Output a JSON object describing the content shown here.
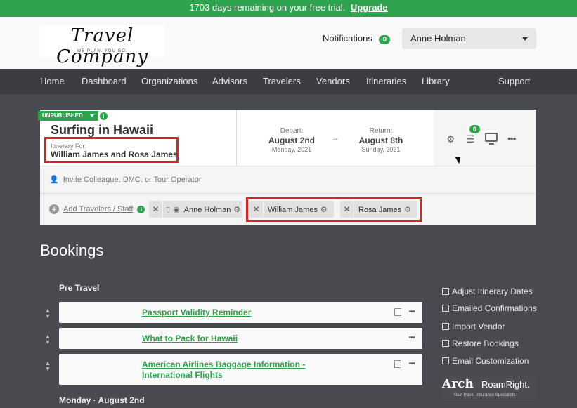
{
  "trial_bar": {
    "text": "1703 days remaining on your free trial.",
    "link": "Upgrade"
  },
  "header": {
    "logo": {
      "title": "Travel Company",
      "tagline": "WE PLAN. YOU GO."
    },
    "notifications_label": "Notifications",
    "notifications_count": "0",
    "user_name": "Anne Holman"
  },
  "nav": [
    "Home",
    "Dashboard",
    "Organizations",
    "Advisors",
    "Travelers",
    "Vendors",
    "Itineraries",
    "Library",
    "Support"
  ],
  "itinerary": {
    "status": "UNPUBLISHED",
    "title": "Surfing in Hawaii",
    "for_label": "Itinerary For:",
    "for_names": "William James and Rosa James",
    "depart": {
      "label": "Depart:",
      "date": "August 2nd",
      "sub": "Monday, 2021"
    },
    "return": {
      "label": "Return:",
      "date": "August 8th",
      "sub": "Sunday, 2021"
    },
    "arrow": "→",
    "checklist_count": "0",
    "invite_text": "Invite Colleague, DMC, or Tour Operator",
    "add_travelers_text": "Add Travelers / Staff",
    "travelers": [
      "Anne Holman",
      "William James",
      "Rosa James"
    ]
  },
  "bookings": {
    "title": "Bookings",
    "sections": [
      {
        "heading": "Pre Travel",
        "items": [
          "Passport Validity Reminder",
          "What to Pack for Hawaii",
          "American Airlines Baggage Information - International Flights"
        ]
      },
      {
        "heading": "Monday · August 2nd"
      }
    ]
  },
  "sidebar_links": [
    "Adjust Itinerary Dates",
    "Emailed Confirmations",
    "Import Vendor",
    "Restore Bookings",
    "Email Customization"
  ],
  "partner_logo": {
    "arch": "Arch",
    "roam": "RoamRight.",
    "tagline": "Your Travel Insurance Specialists"
  },
  "colors": {
    "accent_green": "#2ea44f",
    "nav_bg": "#3c3d41",
    "page_bg": "#484a50",
    "highlight_red": "#e0211d"
  }
}
